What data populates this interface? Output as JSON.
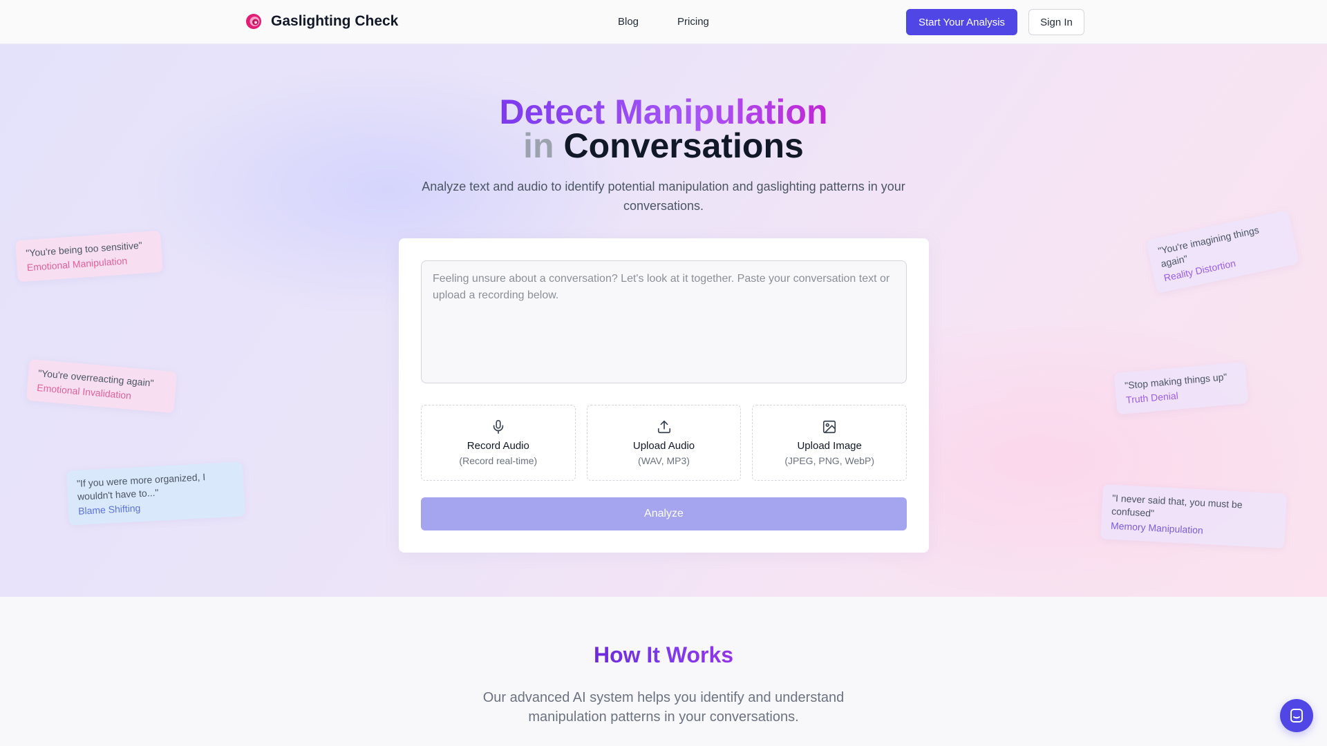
{
  "header": {
    "brand": "Gaslighting Check",
    "nav": [
      "Blog",
      "Pricing"
    ],
    "cta": "Start Your Analysis",
    "signin": "Sign In"
  },
  "hero": {
    "title_line1": "Detect Manipulation",
    "title_line2_a": "in",
    "title_line2_b": "Conversations",
    "subtitle": "Analyze text and audio to identify potential manipulation and gaslighting patterns in your conversations.",
    "input_placeholder": "Feeling unsure about a conversation? Let's look at it together. Paste your conversation text or upload a recording below.",
    "options": [
      {
        "label": "Record Audio",
        "sub": "(Record real-time)",
        "icon": "microphone-icon"
      },
      {
        "label": "Upload Audio",
        "sub": "(WAV, MP3)",
        "icon": "upload-icon"
      },
      {
        "label": "Upload Image",
        "sub": "(JPEG, PNG, WebP)",
        "icon": "image-icon"
      }
    ],
    "analyze": "Analyze",
    "quotes": [
      {
        "quote": "\"You're being too sensitive\"",
        "category": "Emotional Manipulation"
      },
      {
        "quote": "\"You're overreacting again\"",
        "category": "Emotional Invalidation"
      },
      {
        "quote": "\"If you were more organized, I wouldn't have to...\"",
        "category": "Blame Shifting"
      },
      {
        "quote": "\"You're imagining things again\"",
        "category": "Reality Distortion"
      },
      {
        "quote": "\"Stop making things up\"",
        "category": "Truth Denial"
      },
      {
        "quote": "\"I never said that, you must be confused\"",
        "category": "Memory Manipulation"
      }
    ]
  },
  "how": {
    "title": "How It Works",
    "subtitle": "Our advanced AI system helps you identify and understand manipulation patterns in your conversations."
  },
  "colors": {
    "accent": "#4f46e5",
    "analyze_disabled": "#a5a4ee",
    "title_gradient_start": "#7c3aed",
    "title_gradient_end": "#c026d3"
  }
}
